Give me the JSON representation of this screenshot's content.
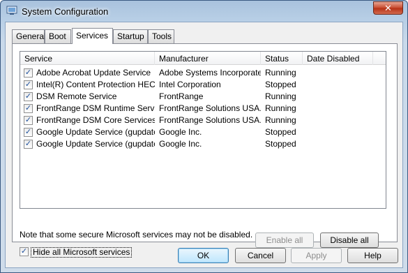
{
  "window": {
    "title": "System Configuration",
    "close_glyph": "✕"
  },
  "tabs": [
    {
      "label": "General",
      "active": false
    },
    {
      "label": "Boot",
      "active": false
    },
    {
      "label": "Services",
      "active": true
    },
    {
      "label": "Startup",
      "active": false
    },
    {
      "label": "Tools",
      "active": false
    }
  ],
  "list": {
    "columns": [
      "Service",
      "Manufacturer",
      "Status",
      "Date Disabled"
    ],
    "rows": [
      {
        "checked": true,
        "service": "Adobe Acrobat Update Service",
        "manufacturer": "Adobe Systems Incorporated",
        "status": "Running",
        "date_disabled": ""
      },
      {
        "checked": true,
        "service": "Intel(R) Content Protection HEC...",
        "manufacturer": "Intel Corporation",
        "status": "Stopped",
        "date_disabled": ""
      },
      {
        "checked": true,
        "service": "DSM Remote Service",
        "manufacturer": "FrontRange",
        "status": "Running",
        "date_disabled": ""
      },
      {
        "checked": true,
        "service": "FrontRange DSM Runtime Service",
        "manufacturer": "FrontRange Solutions USA...",
        "status": "Running",
        "date_disabled": ""
      },
      {
        "checked": true,
        "service": "FrontRange DSM Core Services",
        "manufacturer": "FrontRange Solutions USA...",
        "status": "Running",
        "date_disabled": ""
      },
      {
        "checked": true,
        "service": "Google Update Service (gupdate)",
        "manufacturer": "Google Inc.",
        "status": "Stopped",
        "date_disabled": ""
      },
      {
        "checked": true,
        "service": "Google Update Service (gupdatem)",
        "manufacturer": "Google Inc.",
        "status": "Stopped",
        "date_disabled": ""
      }
    ]
  },
  "note": "Note that some secure Microsoft services may not be disabled.",
  "buttons": {
    "enable_all": "Enable all",
    "disable_all": "Disable all",
    "ok": "OK",
    "cancel": "Cancel",
    "apply": "Apply",
    "help": "Help"
  },
  "hide_ms": {
    "label": "Hide all Microsoft services",
    "checked": true
  },
  "check_glyph": "✓"
}
